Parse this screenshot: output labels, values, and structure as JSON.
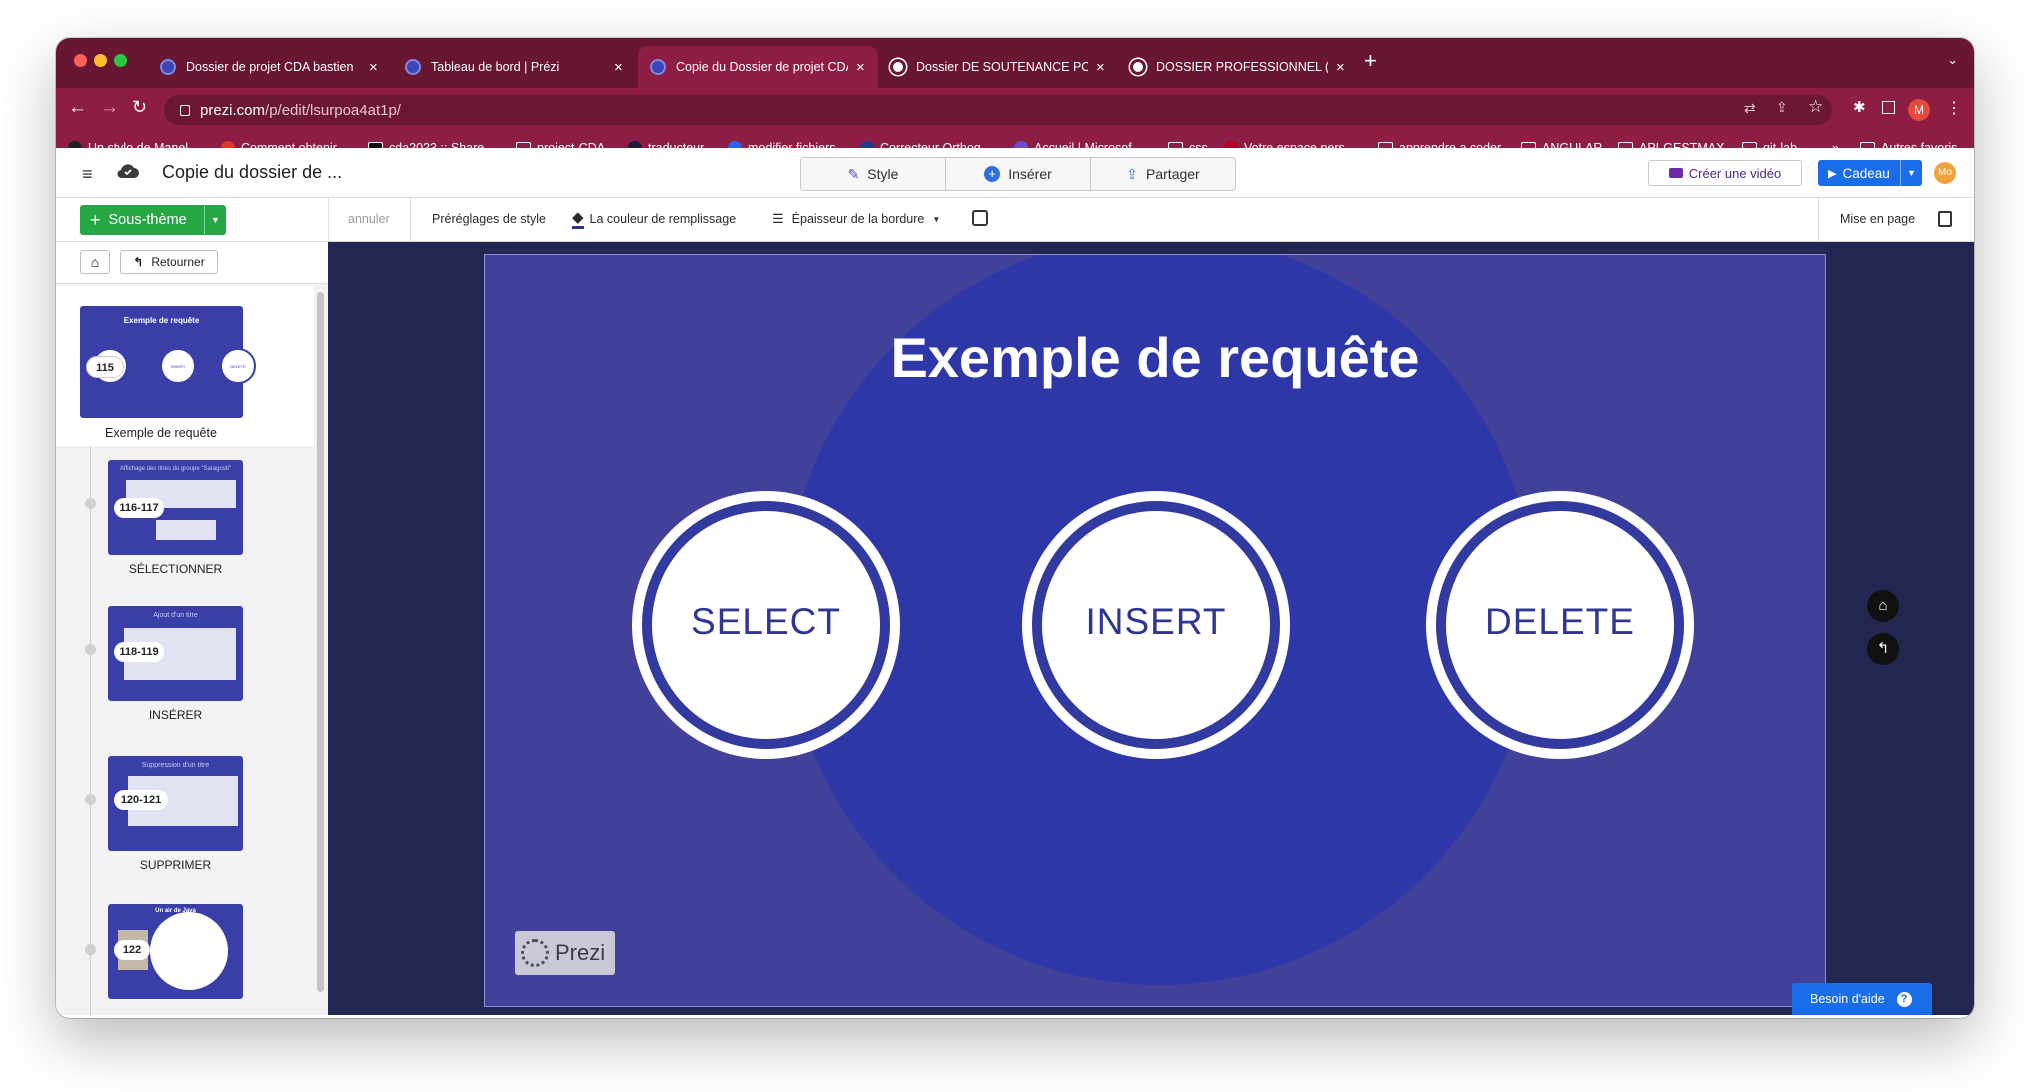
{
  "browser": {
    "tabs": [
      {
        "label": "Dossier de projet CDA bastien",
        "active": false,
        "icon": "prezi-icon"
      },
      {
        "label": "Tableau de bord | Prézi",
        "active": false,
        "icon": "prezi-icon"
      },
      {
        "label": "Copie du Dossier de projet CDA",
        "active": true,
        "icon": "prezi-icon"
      },
      {
        "label": "Dossier DE SOUTENANCE POUR",
        "active": false,
        "icon": "globe-icon"
      },
      {
        "label": "DOSSIER PROFESSIONNEL (DP",
        "active": false,
        "icon": "globe-icon"
      }
    ],
    "url_host": "prezi.com",
    "url_path": "/p/edit/lsurpoa4at1p/",
    "bookmarks": [
      "Un stylo de Manel...",
      "Comment obtenir...",
      "cda2023 :: Share...",
      "project-CDA",
      "traducteur",
      "modifier fichiers",
      "Correcteur Orthog...",
      "Accueil | Microsof...",
      "css",
      "Votre espace pers...",
      "apprendre a coder",
      "ANGULAR",
      "API-GESTMAX",
      "git-lab"
    ],
    "bookmarks_more": "»",
    "other_bookmarks": "Autres favoris",
    "profile_initial": "M"
  },
  "app": {
    "title": "Copie du dossier de ...",
    "style_label": "Style",
    "insert_label": "Insérer",
    "share_label": "Partager",
    "video_label": "Créer une vidéo",
    "gift_label": "Cadeau",
    "user_initials": "Mo"
  },
  "toolbar": {
    "subtheme_label": "Sous-thème",
    "back_label": "Retourner",
    "undo_label": "annuler",
    "style_presets": "Préréglages de style",
    "fill_color": "La couleur de remplissage",
    "border_thickness": "Épaisseur de la bordure",
    "layout_label": "Mise en page"
  },
  "sidebar": {
    "items": [
      {
        "title": "Exemple de requête",
        "number": "115",
        "thumb_title": "Exemple de requête",
        "sub1": "SELECT",
        "sub2": "INSERT",
        "sub3": "DELETE"
      },
      {
        "title": "SÉLECTIONNER",
        "number": "116-117",
        "thumb_title": "Affichage des titres du groupe \"Saragosti\""
      },
      {
        "title": "INSÉRER",
        "number": "118-119",
        "thumb_title": "Ajout d'un titre"
      },
      {
        "title": "SUPPRIMER",
        "number": "120-121",
        "thumb_title": "Suppression d'un titre"
      },
      {
        "title": "",
        "number": "122",
        "thumb_title": "Un air de Java"
      }
    ]
  },
  "slide": {
    "title": "Exemple de requête",
    "circles": [
      "SELECT",
      "INSERT",
      "DELETE"
    ],
    "logo": "Prezi"
  },
  "help_label": "Besoin d'aide"
}
